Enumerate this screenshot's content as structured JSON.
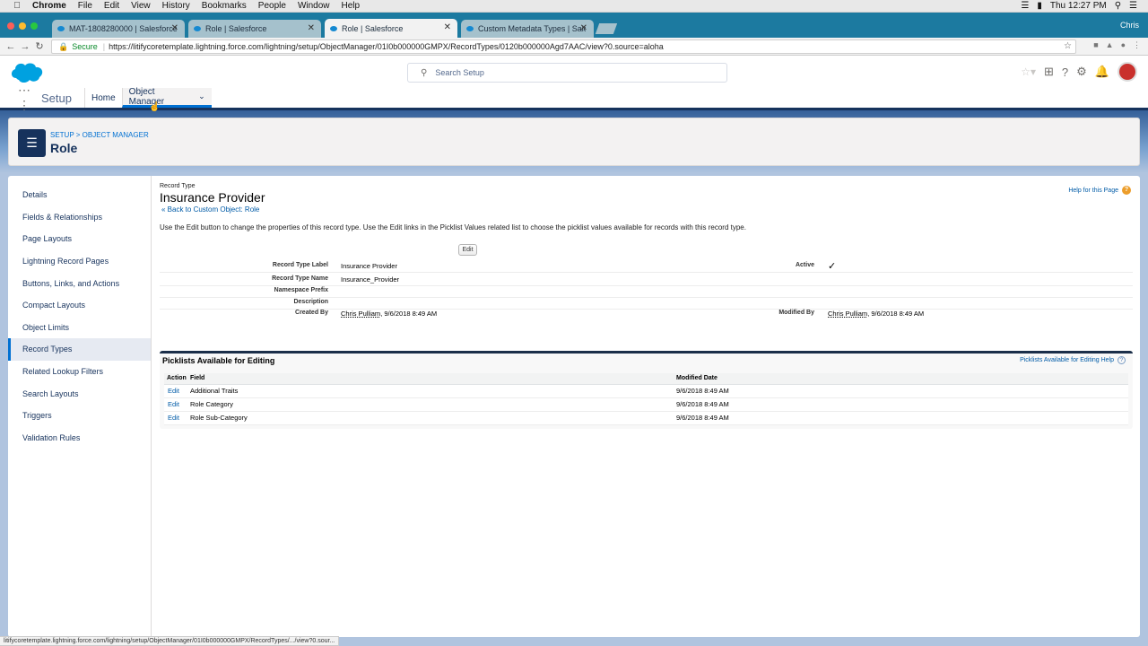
{
  "menubar": {
    "app": "Chrome",
    "items": [
      "File",
      "Edit",
      "View",
      "History",
      "Bookmarks",
      "People",
      "Window",
      "Help"
    ],
    "clock": "Thu 12:27 PM"
  },
  "tabs": [
    {
      "label": "MAT-1808280000 | Salesforce"
    },
    {
      "label": "Role | Salesforce"
    },
    {
      "label": "Role | Salesforce"
    },
    {
      "label": "Custom Metadata Types | Sale"
    }
  ],
  "profile_name": "Chris",
  "address": {
    "secure_label": "Secure",
    "url": "https://litifycoretemplate.lightning.force.com/lightning/setup/ObjectManager/01I0b000000GMPX/RecordTypes/0120b000000Agd7AAC/view?0.source=aloha"
  },
  "header": {
    "search_placeholder": "Search Setup"
  },
  "nav": {
    "app_name": "Setup",
    "home": "Home",
    "object_manager": "Object Manager"
  },
  "page_header": {
    "breadcrumb": "SETUP > OBJECT MANAGER",
    "title": "Role"
  },
  "sidebar": {
    "items": [
      "Details",
      "Fields & Relationships",
      "Page Layouts",
      "Lightning Record Pages",
      "Buttons, Links, and Actions",
      "Compact Layouts",
      "Object Limits",
      "Record Types",
      "Related Lookup Filters",
      "Search Layouts",
      "Triggers",
      "Validation Rules"
    ],
    "active": "Record Types"
  },
  "main": {
    "record_type_label": "Record Type",
    "title": "Insurance Provider",
    "back_link": "« Back to Custom Object: Role",
    "help_page": "Help for this Page",
    "description": "Use the Edit button to change the properties of this record type. Use the Edit links in the Picklist Values related list to choose the picklist values available for records with this record type.",
    "edit_button": "Edit",
    "fields": {
      "record_type_label": {
        "label": "Record Type Label",
        "value": "Insurance Provider"
      },
      "active": {
        "label": "Active",
        "value": "✓"
      },
      "record_type_name": {
        "label": "Record Type Name",
        "value": "Insurance_Provider"
      },
      "namespace_prefix": {
        "label": "Namespace Prefix",
        "value": ""
      },
      "description": {
        "label": "Description",
        "value": ""
      },
      "created_by": {
        "label": "Created By",
        "user": "Chris Pulliam",
        "date": ", 9/6/2018 8:49 AM"
      },
      "modified_by": {
        "label": "Modified By",
        "user": "Chris Pulliam",
        "date": ", 9/6/2018 8:49 AM"
      }
    }
  },
  "picklists": {
    "title": "Picklists Available for Editing",
    "help": "Picklists Available for Editing Help",
    "columns": [
      "Action",
      "Field",
      "Modified Date"
    ],
    "rows": [
      {
        "action": "Edit",
        "field": "Additional Traits",
        "modified": "9/6/2018 8:49 AM"
      },
      {
        "action": "Edit",
        "field": "Role Category",
        "modified": "9/6/2018 8:49 AM"
      },
      {
        "action": "Edit",
        "field": "Role Sub-Category",
        "modified": "9/6/2018 8:49 AM"
      }
    ]
  },
  "statusbar": "litifycoretemplate.lightning.force.com/lightning/setup/ObjectManager/01I0b000000GMPX/RecordTypes/.../view?0.sour..."
}
